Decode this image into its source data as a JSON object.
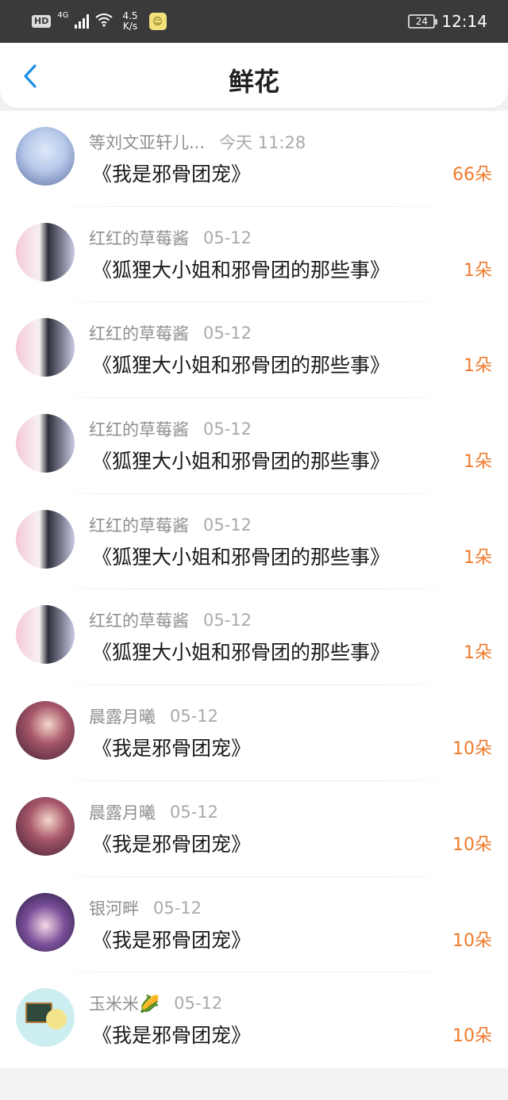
{
  "status_bar": {
    "hd": "HD",
    "network": "4G",
    "speed_value": "4.5",
    "speed_unit": "K/s",
    "battery": "24",
    "time": "12:14"
  },
  "header": {
    "title": "鲜花",
    "back_icon": "chevron-left-icon",
    "accent_color": "#1e90e8"
  },
  "colors": {
    "count": "#f07a2c",
    "meta": "#8f8f8f"
  },
  "items": [
    {
      "name": "等刘文亚轩儿...",
      "date": "今天 11:28",
      "book": "《我是邪骨团宠》",
      "count": "66朵",
      "avatar": "avatar-a"
    },
    {
      "name": "红红的草莓酱",
      "date": "05-12",
      "book": "《狐狸大小姐和邪骨团的那些事》",
      "count": "1朵",
      "avatar": "avatar-b"
    },
    {
      "name": "红红的草莓酱",
      "date": "05-12",
      "book": "《狐狸大小姐和邪骨团的那些事》",
      "count": "1朵",
      "avatar": "avatar-b"
    },
    {
      "name": "红红的草莓酱",
      "date": "05-12",
      "book": "《狐狸大小姐和邪骨团的那些事》",
      "count": "1朵",
      "avatar": "avatar-b"
    },
    {
      "name": "红红的草莓酱",
      "date": "05-12",
      "book": "《狐狸大小姐和邪骨团的那些事》",
      "count": "1朵",
      "avatar": "avatar-b"
    },
    {
      "name": "红红的草莓酱",
      "date": "05-12",
      "book": "《狐狸大小姐和邪骨团的那些事》",
      "count": "1朵",
      "avatar": "avatar-b"
    },
    {
      "name": "晨露月曦",
      "date": "05-12",
      "book": "《我是邪骨团宠》",
      "count": "10朵",
      "avatar": "avatar-c"
    },
    {
      "name": "晨露月曦",
      "date": "05-12",
      "book": "《我是邪骨团宠》",
      "count": "10朵",
      "avatar": "avatar-c"
    },
    {
      "name": "银河畔",
      "date": "05-12",
      "book": "《我是邪骨团宠》",
      "count": "10朵",
      "avatar": "avatar-d"
    },
    {
      "name": "玉米米🌽",
      "date": "05-12",
      "book": "《我是邪骨团宠》",
      "count": "10朵",
      "avatar": "avatar-e"
    }
  ]
}
